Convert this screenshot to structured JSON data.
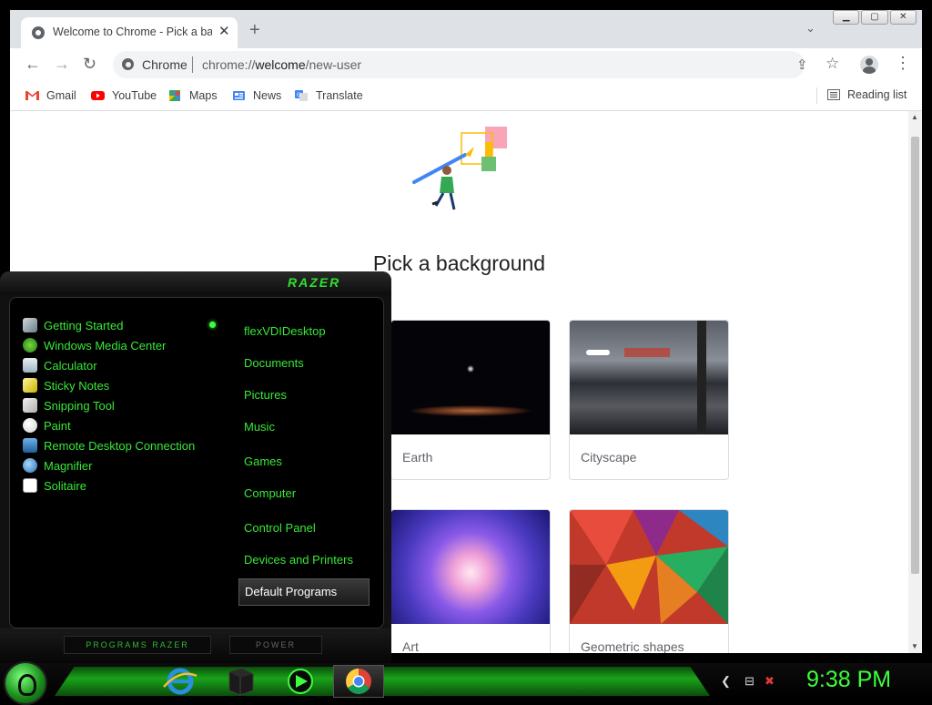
{
  "browser": {
    "tab": {
      "title": "Welcome to Chrome - Pick a background",
      "close": "✕"
    },
    "new_tab": "+",
    "tab_search": "⌄",
    "window_controls": {
      "minimize": "▁",
      "maximize": "▢",
      "close": "✕"
    },
    "nav": {
      "back": "←",
      "forward": "→",
      "reload": "↻"
    },
    "omnibox": {
      "site_name": "Chrome",
      "url_scheme": "chrome://",
      "url_host": "welcome",
      "url_path": "/new-user"
    },
    "omni_share": "⇪",
    "omni_star": "☆",
    "menu": "⋮",
    "bookmarks": [
      {
        "label": "Gmail",
        "icon": "gmail-icon"
      },
      {
        "label": "YouTube",
        "icon": "youtube-icon"
      },
      {
        "label": "Maps",
        "icon": "maps-icon"
      },
      {
        "label": "News",
        "icon": "news-icon"
      },
      {
        "label": "Translate",
        "icon": "translate-icon"
      }
    ],
    "reading_list": "Reading list"
  },
  "page": {
    "heading": "Pick a background",
    "backgrounds": [
      {
        "label": "Earth"
      },
      {
        "label": "Cityscape"
      },
      {
        "label": "Art"
      },
      {
        "label": "Geometric shapes"
      }
    ]
  },
  "start_menu": {
    "logo": "RAZER",
    "programs": [
      {
        "label": "Getting Started",
        "icon": "getting-started-icon"
      },
      {
        "label": "Windows Media Center",
        "icon": "media-center-icon"
      },
      {
        "label": "Calculator",
        "icon": "calculator-icon"
      },
      {
        "label": "Sticky Notes",
        "icon": "sticky-notes-icon"
      },
      {
        "label": "Snipping Tool",
        "icon": "snipping-tool-icon"
      },
      {
        "label": "Paint",
        "icon": "paint-icon"
      },
      {
        "label": "Remote Desktop Connection",
        "icon": "remote-desktop-icon"
      },
      {
        "label": "Magnifier",
        "icon": "magnifier-icon"
      },
      {
        "label": "Solitaire",
        "icon": "solitaire-icon"
      }
    ],
    "places": [
      "flexVDIDesktop",
      "Documents",
      "Pictures",
      "Music",
      "Games",
      "Computer",
      "Control Panel",
      "Devices and Printers",
      "Default Programs"
    ],
    "programs_button": "PROGRAMS  RAZER",
    "power_button": "POWER"
  },
  "taskbar": {
    "apps": [
      {
        "name": "internet-explorer-icon"
      },
      {
        "name": "razer-cube-icon"
      },
      {
        "name": "media-player-icon"
      },
      {
        "name": "chrome-icon",
        "active": true
      }
    ],
    "tray": {
      "back": "❮",
      "network": "⊟",
      "volume": "✖"
    },
    "clock": "9:38 PM"
  },
  "colors": {
    "accent_green": "#38e838",
    "chrome_tab_strip": "#dee1e6"
  }
}
